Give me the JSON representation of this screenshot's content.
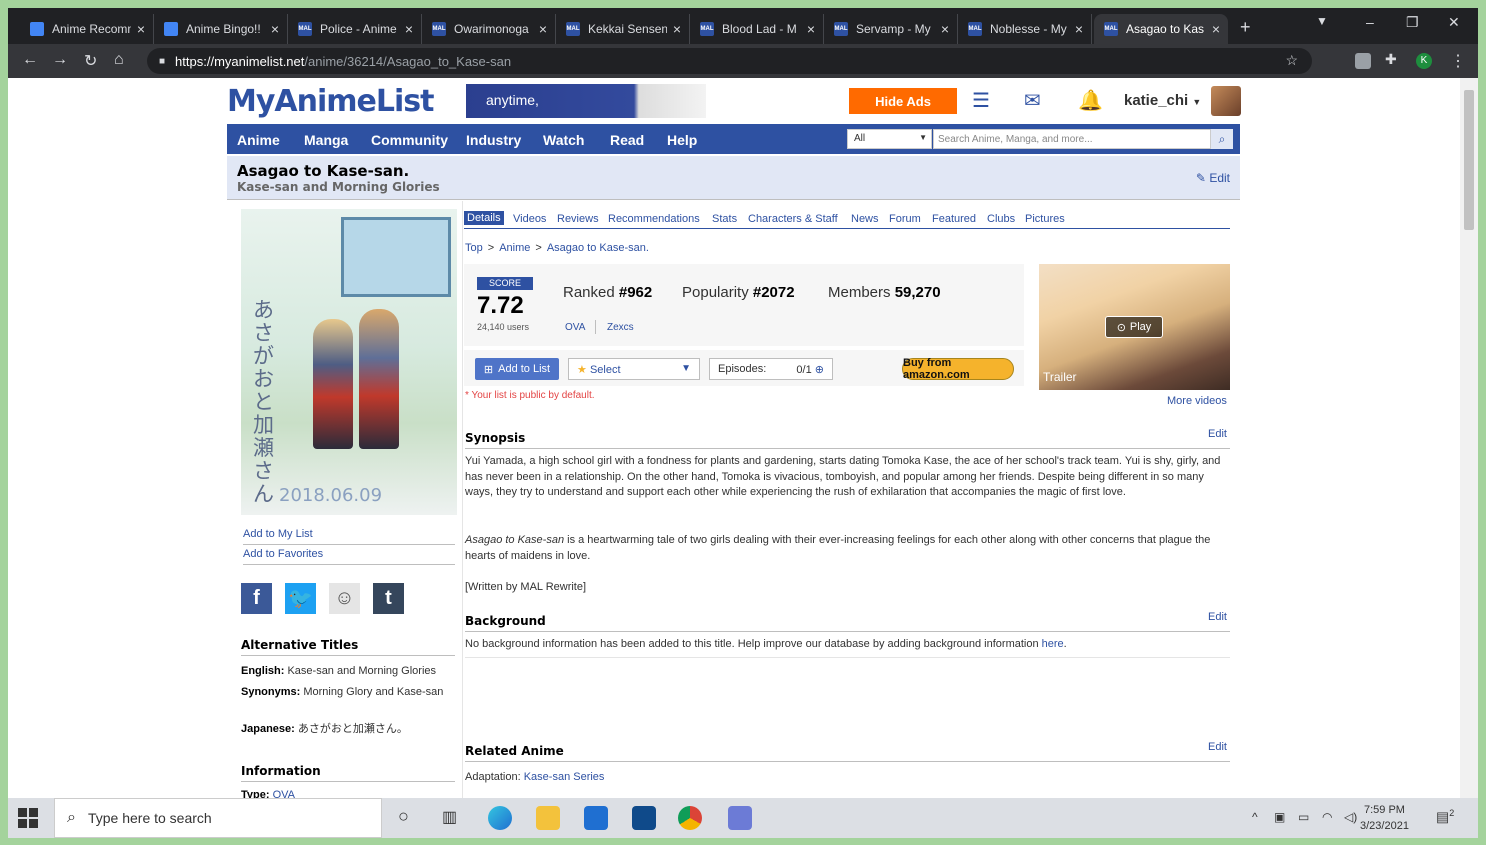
{
  "browser": {
    "tabs": [
      {
        "title": "Anime Recomm",
        "icon": "docs-icon"
      },
      {
        "title": "Anime Bingo!!",
        "icon": "docs-icon"
      },
      {
        "title": "Police - Anime",
        "icon": "mal-icon"
      },
      {
        "title": "Owarimonoga",
        "icon": "mal-icon"
      },
      {
        "title": "Kekkai Sensen",
        "icon": "mal-icon"
      },
      {
        "title": "Blood Lad - M",
        "icon": "mal-icon"
      },
      {
        "title": "Servamp - My",
        "icon": "mal-icon"
      },
      {
        "title": "Noblesse - My",
        "icon": "mal-icon"
      },
      {
        "title": "Asagao to Kas",
        "icon": "mal-icon",
        "active": true
      }
    ],
    "url_host": "https://myanimelist.net",
    "url_path": "/anime/36214/Asagao_to_Kase-san",
    "profile_initial": "K",
    "tab_icon_text": "MAL"
  },
  "header": {
    "logo": "MyAnimeList",
    "banner_text": "anytime,",
    "hide_ads": "Hide Ads",
    "username": "katie_chi"
  },
  "nav": {
    "items": [
      "Anime",
      "Manga",
      "Community",
      "Industry",
      "Watch",
      "Read",
      "Help"
    ],
    "search_scope": "All",
    "search_placeholder": "Search Anime, Manga, and more..."
  },
  "title": {
    "main": "Asagao to Kase-san.",
    "sub": "Kase-san and Morning Glories",
    "edit": "Edit"
  },
  "left": {
    "poster_kana": "あさがおと加瀬さん",
    "poster_date": "2018.06.09",
    "add_to_list": "Add to My List",
    "add_to_favorites": "Add to Favorites",
    "alt_titles_head": "Alternative Titles",
    "english_label": "English:",
    "english_value": "Kase-san and Morning Glories",
    "synonyms_label": "Synonyms:",
    "synonyms_value": "Morning Glory and Kase-san",
    "japanese_label": "Japanese:",
    "japanese_value": "あさがおと加瀬さん。",
    "info_head": "Information",
    "type_label": "Type:",
    "type_value": "OVA"
  },
  "main": {
    "tabs": [
      "Details",
      "Videos",
      "Reviews",
      "Recommendations",
      "Stats",
      "Characters & Staff",
      "News",
      "Forum",
      "Featured",
      "Clubs",
      "Pictures"
    ],
    "crumbs": [
      "Top",
      "Anime",
      "Asagao to Kase-san."
    ],
    "crumb_sep": ">",
    "score_label": "SCORE",
    "score": "7.72",
    "score_users": "24,140 users",
    "ranked_label": "Ranked",
    "ranked": "#962",
    "popularity_label": "Popularity",
    "popularity": "#2072",
    "members_label": "Members",
    "members": "59,270",
    "type_tag": "OVA",
    "studio_tag": "Zexcs",
    "add_to_list": "Add to List",
    "select": "Select",
    "episodes_label": "Episodes:",
    "episodes_value": "0/1",
    "amazon": "Buy from amazon.com",
    "public_note": "* Your list is public by default.",
    "trailer_label": "Trailer",
    "play": "Play",
    "more_videos": "More videos",
    "synopsis_head": "Synopsis",
    "edit": "Edit",
    "synopsis_p1": "Yui Yamada, a high school girl with a fondness for plants and gardening, starts dating Tomoka Kase, the ace of her school's track team. Yui is shy, girly, and has never been in a relationship. On the other hand, Tomoka is vivacious, tomboyish, and popular among her friends. Despite being different in so many ways, they try to understand and support each other while experiencing the rush of exhilaration that accompanies the magic of first love.",
    "synopsis_p2_italic": "Asagao to Kase-san",
    "synopsis_p2_rest": " is a heartwarming tale of two girls dealing with their ever-increasing feelings for each other along with other concerns that plague the hearts of maidens in love.",
    "synopsis_credit": "[Written by MAL Rewrite]",
    "background_head": "Background",
    "background_text": "No background information has been added to this title. Help improve our database by adding background information ",
    "background_link": "here",
    "related_head": "Related Anime",
    "adaptation_label": "Adaptation:",
    "adaptation_value": "Kase-san Series"
  },
  "taskbar": {
    "search_placeholder": "Type here to search",
    "time": "7:59 PM",
    "date": "3/23/2021",
    "notification_count": "2"
  }
}
